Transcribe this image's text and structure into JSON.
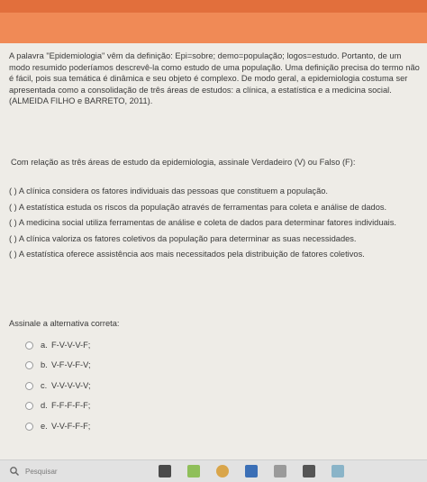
{
  "intro_text": "A palavra \"Epidemiologia\" vêm da definição: Epi=sobre; demo=população; logos=estudo. Portanto, de um modo resumido poderíamos descrevê-la como estudo de uma população. Uma definição precisa do termo não é fácil, pois sua temática é dinâmica e seu objeto é complexo. De modo geral, a epidemiologia costuma ser apresentada como a consolidação de três áreas de estudos: a clínica, a estatística e a medicina social. (ALMEIDA FILHO e BARRETO, 2011).",
  "question_text": "Com relação as três áreas de estudo da epidemiologia, assinale Verdadeiro (V) ou Falso (F):",
  "statements": [
    "( ) A clínica considera os fatores individuais das pessoas que constituem a população.",
    "( ) A estatística estuda os riscos da população através de ferramentas para coleta e análise de dados.",
    "( ) A medicina social utiliza ferramentas de análise e coleta de dados para determinar fatores individuais.",
    "( ) A clínica valoriza os fatores coletivos da população para determinar as suas necessidades.",
    "( ) A estatística oferece assistência aos mais necessitados pela distribuição de fatores coletivos."
  ],
  "prompt_text": "Assinale a alternativa correta:",
  "options": [
    {
      "letter": "a.",
      "text": "F-V-V-V-F;"
    },
    {
      "letter": "b.",
      "text": "V-F-V-F-V;"
    },
    {
      "letter": "c.",
      "text": "V-V-V-V-V;"
    },
    {
      "letter": "d.",
      "text": "F-F-F-F-F;"
    },
    {
      "letter": "e.",
      "text": "V-V-F-F-F;"
    }
  ],
  "taskbar": {
    "search_placeholder": "Pesquisar",
    "search_icon": "search-icon"
  },
  "colors": {
    "header_orange": "#f08a56",
    "background": "#eeece7"
  }
}
